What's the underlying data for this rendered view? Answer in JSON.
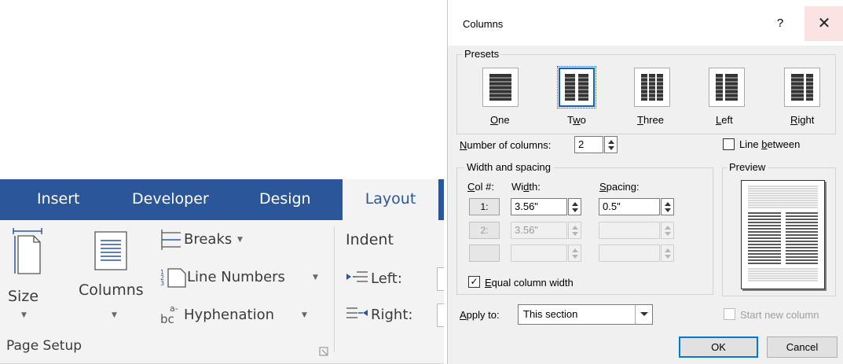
{
  "ribbon": {
    "tabs": [
      "Insert",
      "Developer",
      "Design",
      "Layout"
    ],
    "active_tab": "Layout",
    "size_label": "Size",
    "columns_label": "Columns",
    "breaks_label": "Breaks",
    "line_numbers_label": "Line Numbers",
    "hyphenation_label": "Hyphenation",
    "indent_label": "Indent",
    "left_label": "Left:",
    "right_label": "Right:",
    "group_label": "Page Setup",
    "accent_color": "#2b579a"
  },
  "dialog": {
    "title": "Columns",
    "help": "?",
    "close": "✕",
    "presets_label": "Presets",
    "presets": [
      {
        "name": "One",
        "accel": "O",
        "rest": "ne"
      },
      {
        "name": "Two",
        "accel": "w",
        "pre": "T",
        "rest": "o"
      },
      {
        "name": "Three",
        "accel": "T",
        "rest": "hree"
      },
      {
        "name": "Left",
        "accel": "L",
        "rest": "eft"
      },
      {
        "name": "Right",
        "accel": "R",
        "rest": "ight"
      }
    ],
    "selected_preset": "Two",
    "number_of_columns": {
      "accel": "N",
      "rest": "umber of columns:",
      "value": "2"
    },
    "line_between": {
      "pre": "Line ",
      "accel": "b",
      "rest": "etween",
      "checked": false
    },
    "width_spacing_label": "Width and spacing",
    "col_header": {
      "accel": "C",
      "rest": "ol #:"
    },
    "width_header": {
      "pre": "Wi",
      "accel": "d",
      "rest": "th:"
    },
    "spacing_header": {
      "accel": "S",
      "rest": "pacing:"
    },
    "rows": [
      {
        "col": "1:",
        "width": "3.56\"",
        "spacing": "0.5\"",
        "enabled": true
      },
      {
        "col": "2:",
        "width": "3.56\"",
        "spacing": "",
        "enabled": false
      },
      {
        "col": "",
        "width": "",
        "spacing": "",
        "enabled": false
      }
    ],
    "equal_width": {
      "accel": "E",
      "rest": "qual column width",
      "checked": true,
      "check_glyph": "✓"
    },
    "preview_label": "Preview",
    "apply_to": {
      "accel": "A",
      "rest": "pply to:",
      "value": "This section"
    },
    "start_new_column": {
      "label": "Start new column",
      "checked": false,
      "enabled": false
    },
    "ok_label": "OK",
    "cancel_label": "Cancel"
  }
}
